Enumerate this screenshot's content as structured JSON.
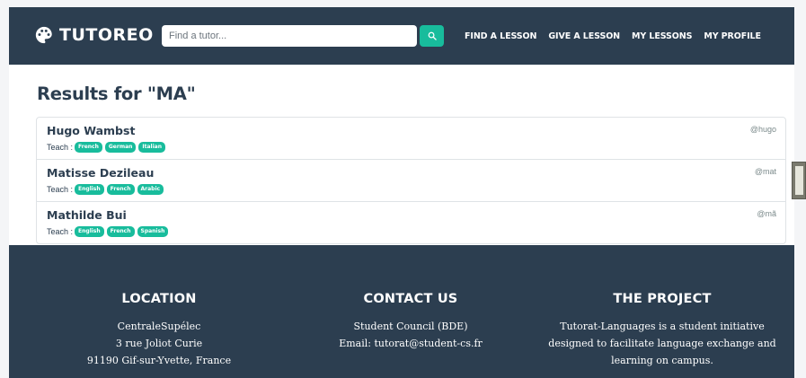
{
  "navbar": {
    "brand": "TUTOREO",
    "search_placeholder": "Find a tutor...",
    "links": [
      "FIND A LESSON",
      "GIVE A LESSON",
      "MY LESSONS",
      "MY PROFILE"
    ]
  },
  "results": {
    "title": "Results for \"MA\"",
    "teach_label": "Teach :",
    "items": [
      {
        "name": "Hugo Wambst",
        "handle": "@hugo",
        "languages": [
          "French",
          "German",
          "Italian"
        ]
      },
      {
        "name": "Matisse Dezileau",
        "handle": "@mat",
        "languages": [
          "English",
          "French",
          "Arabic"
        ]
      },
      {
        "name": "Mathilde Bui",
        "handle": "@mã",
        "languages": [
          "English",
          "French",
          "Spanish"
        ]
      }
    ]
  },
  "footer": {
    "location": {
      "title": "LOCATION",
      "lines": [
        "CentraleSupélec",
        "3 rue Joliot Curie",
        "91190 Gif-sur-Yvette, France"
      ]
    },
    "contact": {
      "title": "CONTACT US",
      "lines": [
        "Student Council (BDE)",
        "Email: tutorat@student-cs.fr"
      ]
    },
    "project": {
      "title": "THE PROJECT",
      "lines": [
        "Tutorat-Languages is a student initiative",
        "designed to facilitate language exchange and",
        "learning on campus."
      ]
    }
  },
  "colors": {
    "primary": "#2c3e50",
    "accent": "#18bc9c"
  },
  "icons": {
    "brand": "palette-icon",
    "search": "search-icon"
  }
}
